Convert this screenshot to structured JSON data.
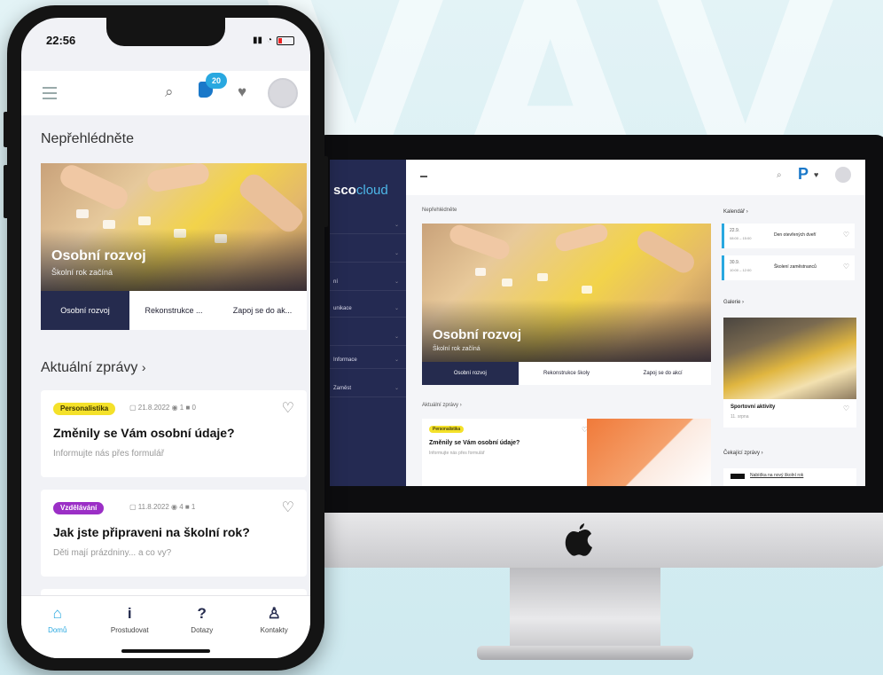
{
  "phone": {
    "status_time": "22:56",
    "notif_count": "20",
    "section_title": "Nepřehlédněte",
    "hero": {
      "title": "Osobní rozvoj",
      "subtitle": "Školní rok začíná"
    },
    "hero_tabs": [
      "Osobní rozvoj",
      "Rekonstrukce ...",
      "Zapoj se do ak..."
    ],
    "news_title": "Aktuální zprávy",
    "news": [
      {
        "tag": "Personalistika",
        "tag_color": "#f4e12a",
        "tag_text_color": "#3a3300",
        "meta": "▢ 21.8.2022  ◉ 1  ■ 0",
        "title": "Změnily se Vám osobní údaje?",
        "subtitle": "Informujte nás přes formulář"
      },
      {
        "tag": "Vzdělávání",
        "tag_color": "#9b2fc6",
        "tag_text_color": "#ffffff",
        "meta": "▢ 11.8.2022  ◉ 4  ■ 1",
        "title": "Jak jste připraveni na školní rok?",
        "subtitle": "Děti mají prázdniny... a co vy?"
      }
    ],
    "bottom_nav": [
      {
        "icon": "⌂",
        "label": "Domů"
      },
      {
        "icon": "i",
        "label": "Prostudovat"
      },
      {
        "icon": "?",
        "label": "Dotazy"
      },
      {
        "icon": "♙",
        "label": "Kontakty"
      }
    ]
  },
  "desktop": {
    "logo_bold": "sco",
    "logo_light": "cloud",
    "sidebar_items": [
      "",
      "",
      "ní",
      "unikace",
      "",
      "Informace",
      "Zaměst"
    ],
    "section_title": "Nepřehlédněte",
    "hero": {
      "title": "Osobní rozvoj",
      "subtitle": "Školní rok začíná"
    },
    "hero_tabs": [
      "Osobní rozvoj",
      "Rekonstrukce školy",
      "Zapoj se do akcí"
    ],
    "news_title": "Aktuální zprávy",
    "news_tag": "Personalistika",
    "news_title_item": "Změnily se Vám osobní údaje?",
    "news_subtitle": "Informujte nás přes formulář",
    "calendar_title": "Kalendář",
    "events": [
      {
        "date": "22.9.",
        "time": "08:00 – 15:00",
        "title": "Den otevřených dveří"
      },
      {
        "date": "30.9.",
        "time": "10:00 – 12:00",
        "title": "Školení zaměstnanců"
      }
    ],
    "gallery_title": "Galerie",
    "gallery_caption": "Sportovní aktivity",
    "gallery_sub": "11. srpna",
    "chat_title": "Čekající zprávy",
    "chat_item": "Nabídka na nový školní rok"
  }
}
